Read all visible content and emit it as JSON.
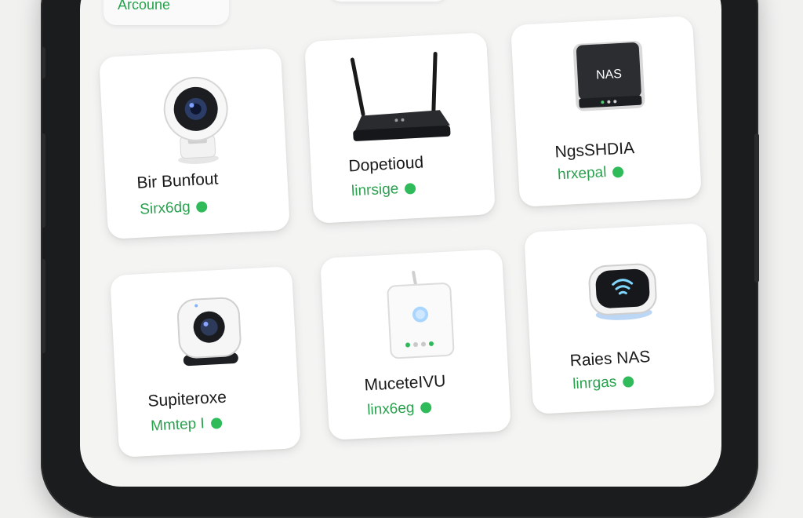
{
  "header": {
    "account_label": "Arcoune"
  },
  "devices": [
    {
      "name": "Bir Bunfout",
      "status": "Sirx6dg",
      "icon": "security-camera-icon"
    },
    {
      "name": "Dopetioud",
      "status": "linrsige",
      "icon": "router-icon"
    },
    {
      "name": "NgsSHDIA",
      "status": "hrxepal",
      "icon": "nas-icon",
      "device_label": "NAS"
    },
    {
      "name": "Supiteroxe",
      "status": "Mmtep I",
      "icon": "webcam-icon"
    },
    {
      "name": "MuceteIVU",
      "status": "linx6eg",
      "icon": "hub-icon"
    },
    {
      "name": "Raies NAS",
      "status": "linrgas",
      "icon": "smart-speaker-icon"
    }
  ],
  "colors": {
    "accent": "#2aa14e",
    "status_dot": "#2fbb5a",
    "card_bg": "#ffffff"
  }
}
